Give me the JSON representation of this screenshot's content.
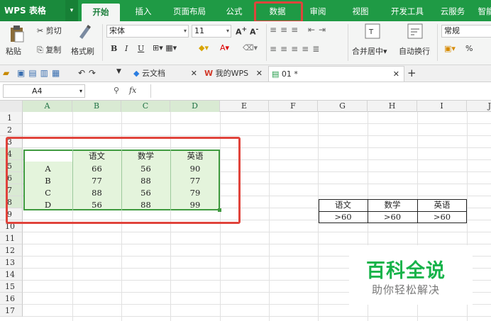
{
  "app": {
    "logo": "WPS 表格",
    "logo_arrow": "▾"
  },
  "menu_tabs": [
    "开始",
    "插入",
    "页面布局",
    "公式",
    "数据",
    "审阅",
    "视图",
    "开发工具",
    "云服务",
    "智能"
  ],
  "ribbon": {
    "paste": "粘贴",
    "cut": "剪切",
    "copy": "复制",
    "format_painter": "格式刷",
    "font": "宋体",
    "font_size": "11",
    "merge": "合并居中",
    "wrap": "自动换行",
    "number_format": "常规",
    "percent": "%"
  },
  "quickbar": {
    "tab_cloud": "云文档",
    "tab_mywps": "我的WPS",
    "tab_file": "01 *",
    "add": "+"
  },
  "formula": {
    "cell_ref": "A4",
    "fx": "fx"
  },
  "columns": [
    "A",
    "B",
    "C",
    "D",
    "E",
    "F",
    "G",
    "H",
    "I",
    "J"
  ],
  "rows": [
    "1",
    "2",
    "3",
    "4",
    "5",
    "6",
    "7",
    "8",
    "9",
    "10",
    "11",
    "12",
    "13",
    "14",
    "15",
    "16",
    "17"
  ],
  "table": {
    "headers": [
      "",
      "语文",
      "数学",
      "英语"
    ],
    "rows": [
      [
        "A",
        "66",
        "56",
        "90"
      ],
      [
        "B",
        "77",
        "88",
        "77"
      ],
      [
        "C",
        "88",
        "56",
        "79"
      ],
      [
        "D",
        "56",
        "88",
        "99"
      ]
    ]
  },
  "criteria": {
    "headers": [
      "语文",
      "数学",
      "英语"
    ],
    "values": [
      ">60",
      ">60",
      ">60"
    ]
  },
  "watermark": {
    "title": "百科全说",
    "subtitle": "助你轻松解决"
  },
  "colors": {
    "accent": "#1f9a45",
    "highlight": "#e0443c",
    "fill": "#e4f4dc"
  }
}
